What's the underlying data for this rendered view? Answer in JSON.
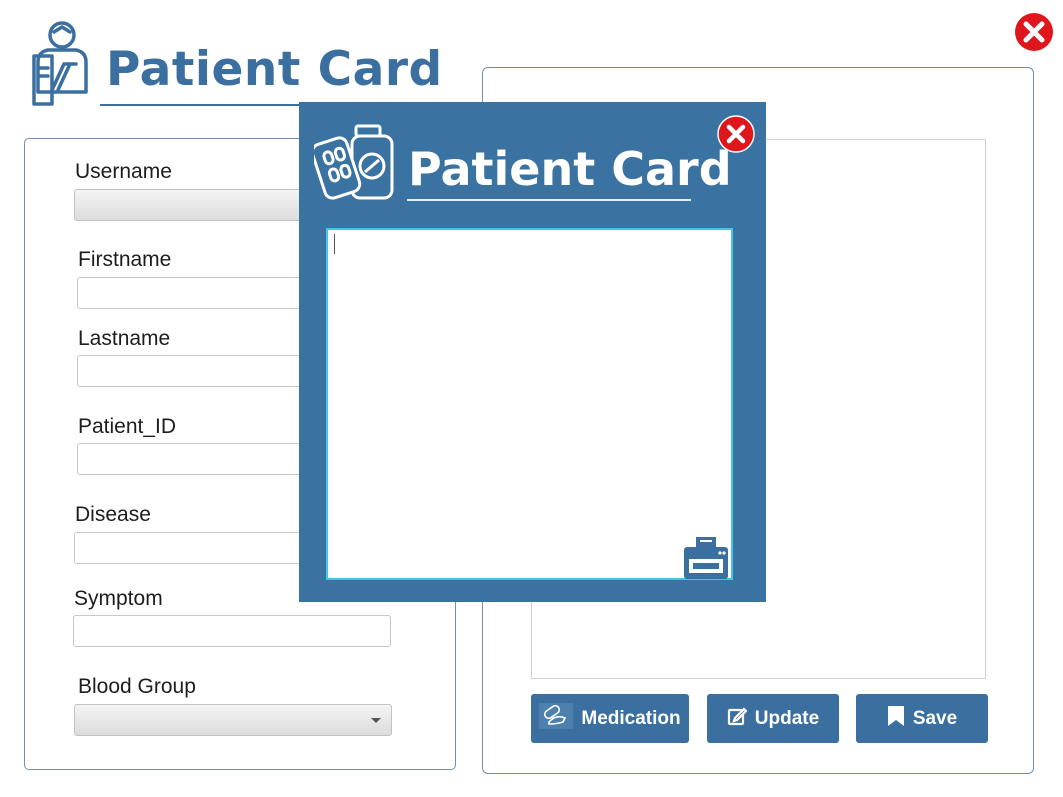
{
  "app": {
    "title": "Patient Card"
  },
  "form": {
    "username_label": "Username",
    "firstname_label": "Firstname",
    "lastname_label": "Lastname",
    "patient_id_label": "Patient_ID",
    "disease_label": "Disease",
    "symptom_label": "Symptom",
    "blood_group_label": "Blood Group",
    "username_value": "",
    "firstname_value": "",
    "lastname_value": "",
    "patient_id_value": "",
    "disease_value": "",
    "symptom_value": "",
    "blood_group_value": ""
  },
  "actions": {
    "medication_label": "Medication",
    "update_label": "Update",
    "save_label": "Save"
  },
  "modal": {
    "title": "Patient Card",
    "notes_value": ""
  },
  "icons": {
    "main_logo": "doctor-clipboard-icon",
    "main_close": "close-icon",
    "modal_logo": "medicine-bottle-icon",
    "modal_close": "close-icon",
    "print": "printer-icon",
    "medication": "pills-icon",
    "update": "edit-icon",
    "save": "bookmark-icon"
  },
  "colors": {
    "brand": "#3b6fa0",
    "modal_bg": "#3a72a2",
    "close_red": "#e0161d",
    "textarea_border": "#42c6e6"
  }
}
